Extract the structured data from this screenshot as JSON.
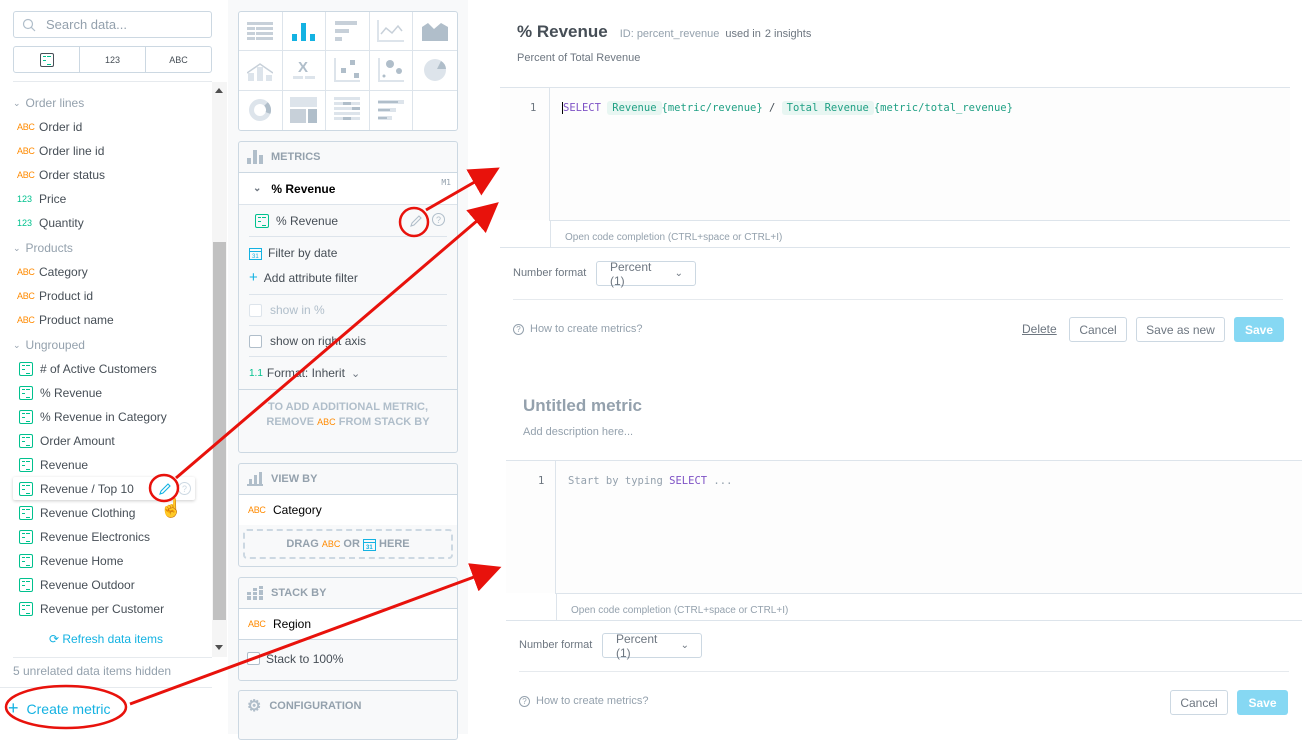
{
  "left_panel": {
    "search_placeholder": "Search data...",
    "type_filters": [
      "metric-icon",
      "123",
      "ABC"
    ],
    "groups": [
      {
        "label": "Order lines",
        "items": [
          {
            "type": "ABC",
            "label": "Order id"
          },
          {
            "type": "ABC",
            "label": "Order line id"
          },
          {
            "type": "ABC",
            "label": "Order status"
          },
          {
            "type": "123",
            "label": "Price"
          },
          {
            "type": "123",
            "label": "Quantity"
          }
        ]
      },
      {
        "label": "Products",
        "items": [
          {
            "type": "ABC",
            "label": "Category"
          },
          {
            "type": "ABC",
            "label": "Product id"
          },
          {
            "type": "ABC",
            "label": "Product name"
          }
        ]
      },
      {
        "label": "Ungrouped",
        "items": [
          {
            "type": "metric",
            "label": "# of Active Customers"
          },
          {
            "type": "metric",
            "label": "% Revenue"
          },
          {
            "type": "metric",
            "label": "% Revenue in Category"
          },
          {
            "type": "metric",
            "label": "Order Amount"
          },
          {
            "type": "metric",
            "label": "Revenue"
          },
          {
            "type": "metric",
            "label": "Revenue / Top 10"
          },
          {
            "type": "metric",
            "label": "Revenue Clothing"
          },
          {
            "type": "metric",
            "label": "Revenue Electronics"
          },
          {
            "type": "metric",
            "label": "Revenue Home"
          },
          {
            "type": "metric",
            "label": "Revenue Outdoor"
          },
          {
            "type": "metric",
            "label": "Revenue per Customer"
          }
        ]
      }
    ],
    "refresh_label": "Refresh data items",
    "hidden_label": "5 unrelated data items hidden",
    "create_metric_label": "Create metric"
  },
  "middle_panel": {
    "viz_types": [
      "table",
      "column",
      "bar",
      "line",
      "area",
      "combo",
      "headline",
      "scatter",
      "bubble",
      "pie",
      "donut",
      "treemap",
      "heatmap",
      "bullet"
    ],
    "selected_viz": "column",
    "metrics": {
      "header": "METRICS",
      "item_title": "% Revenue",
      "item_badge": "M1",
      "metric_name": "% Revenue",
      "filter_by_date": "Filter by date",
      "add_attribute_filter": "Add attribute filter",
      "show_in_percent": "show in %",
      "show_on_right_axis": "show on right axis",
      "format_prefix": "1.1",
      "format_label": "Format: Inherit",
      "hint_line1": "TO ADD ADDITIONAL METRIC,",
      "hint_line2_a": "REMOVE",
      "hint_line2_tag": "ABC",
      "hint_line2_b": "FROM STACK BY"
    },
    "view_by": {
      "header": "VIEW BY",
      "item_tag": "ABC",
      "item": "Category",
      "drop_a": "DRAG",
      "drop_tag": "ABC",
      "drop_b": "OR",
      "drop_c": "HERE"
    },
    "stack_by": {
      "header": "STACK BY",
      "item_tag": "ABC",
      "item": "Region",
      "stack_to_100": "Stack to 100%"
    },
    "configuration": {
      "header": "CONFIGURATION"
    }
  },
  "edit_dialog": {
    "title": "% Revenue",
    "id_label": "ID: percent_revenue",
    "used_in": "used in",
    "insights": "2 insights",
    "description": "Percent of Total Revenue",
    "line_number": "1",
    "code": {
      "keyword": "SELECT",
      "chip1": "Revenue",
      "ref1": "{metric/revenue}",
      "op": "/",
      "chip2": "Total Revenue",
      "ref2": "{metric/total_revenue}"
    },
    "completion_hint": "Open code completion (CTRL+space or CTRL+I)",
    "number_format_label": "Number format",
    "number_format_value": "Percent (1)",
    "help_link": "How to create metrics?",
    "delete": "Delete",
    "cancel": "Cancel",
    "save_as_new": "Save as new",
    "save": "Save"
  },
  "create_dialog": {
    "title": "Untitled metric",
    "description_placeholder": "Add description here...",
    "line_number": "1",
    "code_placeholder_a": "Start by typing",
    "code_placeholder_kw": "SELECT",
    "code_placeholder_b": "...",
    "completion_hint": "Open code completion (CTRL+space or CTRL+I)",
    "number_format_label": "Number format",
    "number_format_value": "Percent (1)",
    "help_link": "How to create metrics?",
    "cancel": "Cancel",
    "save": "Save"
  },
  "colors": {
    "accent": "#14b2e2",
    "attribute": "#ff8a00",
    "fact": "#00c18e",
    "annotation": "#e8120c"
  }
}
